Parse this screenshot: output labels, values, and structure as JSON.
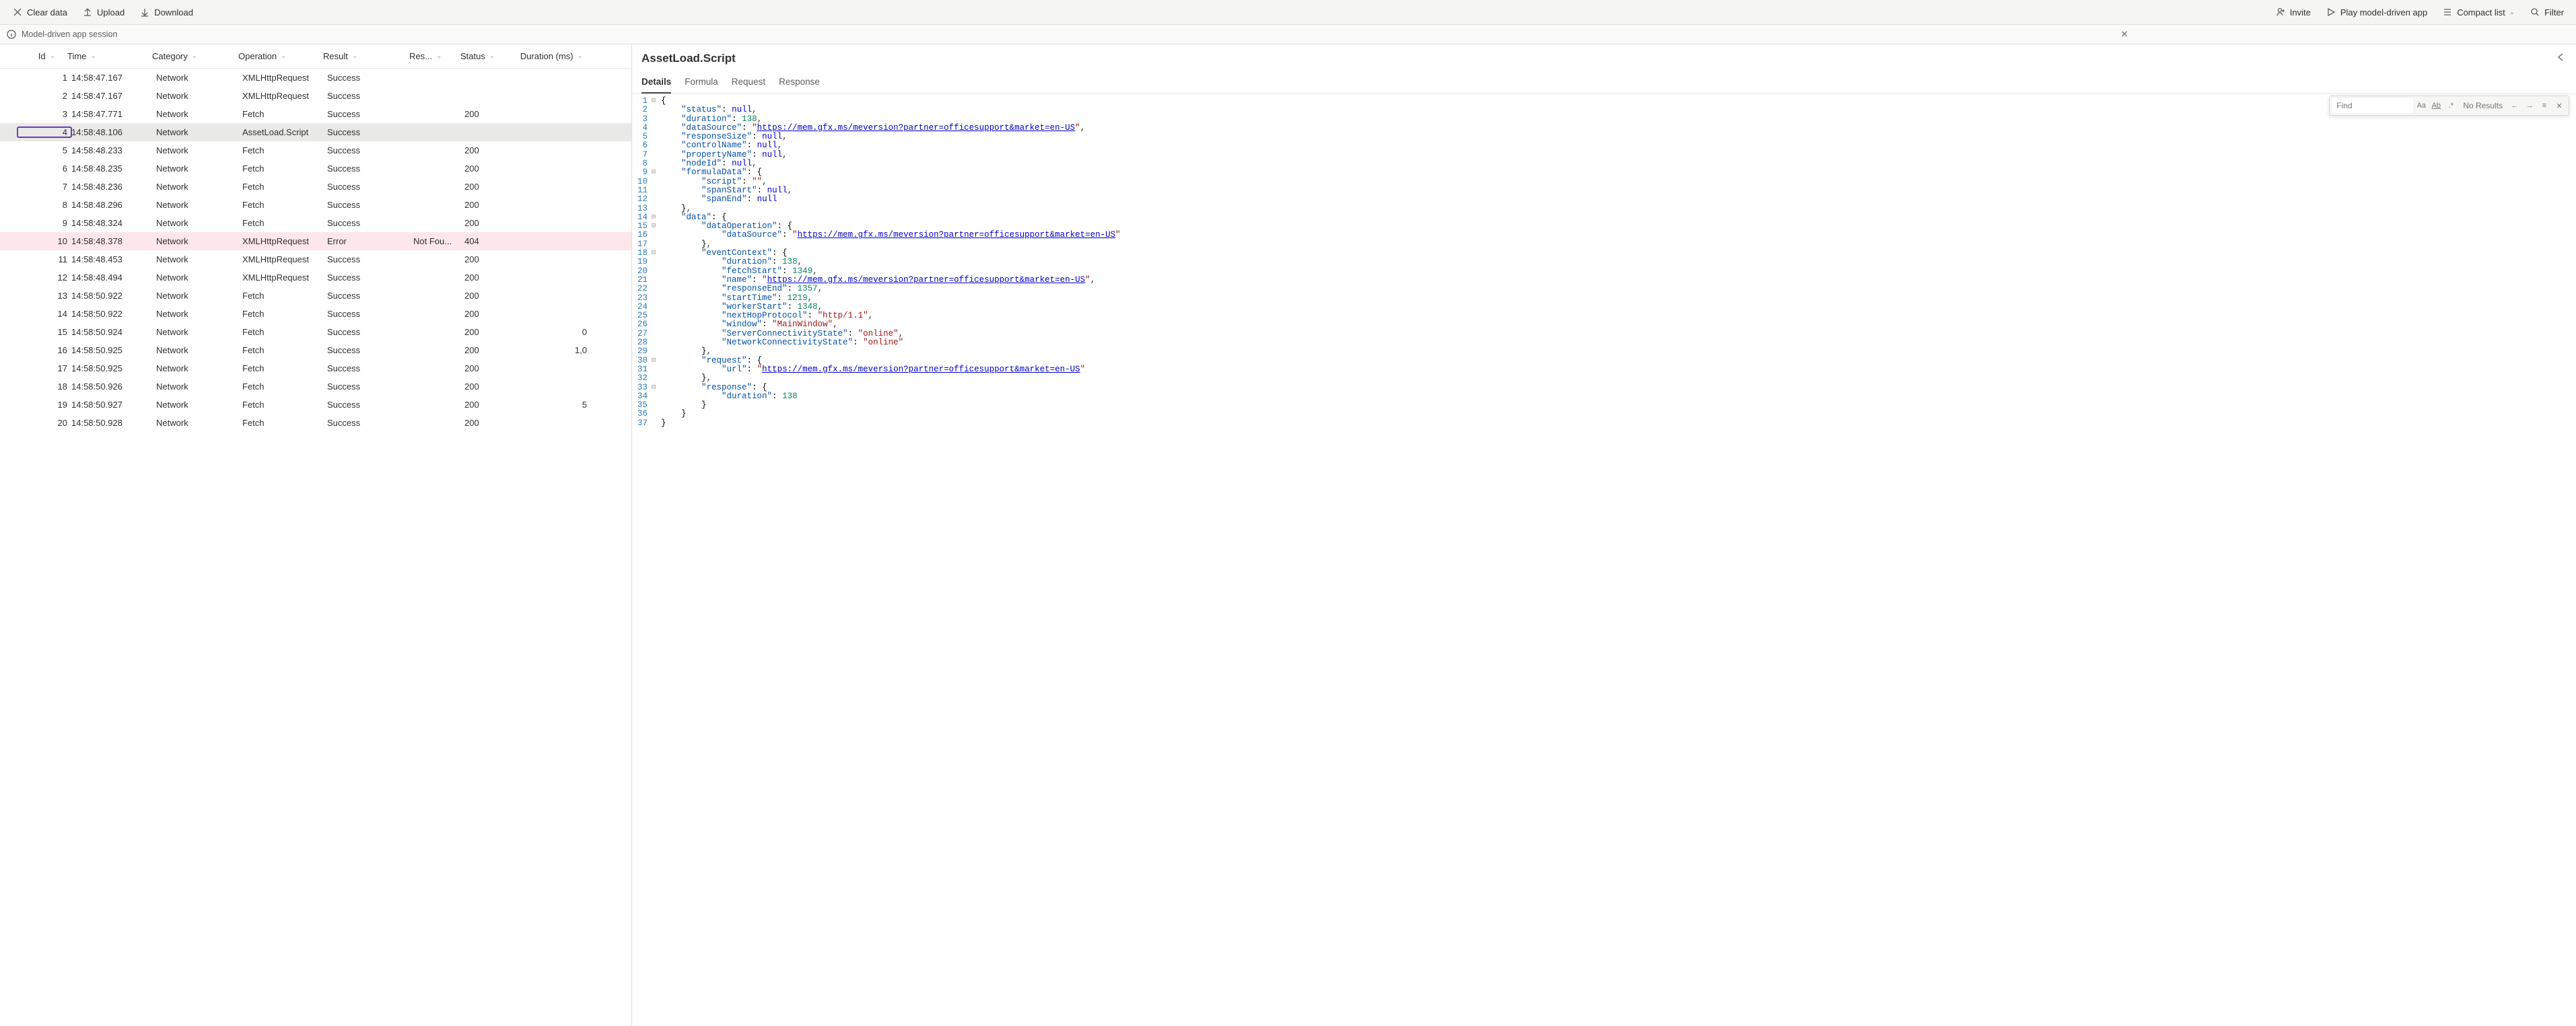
{
  "toolbar": {
    "clear": "Clear data",
    "upload": "Upload",
    "download": "Download",
    "invite": "Invite",
    "play": "Play model-driven app",
    "compact": "Compact list",
    "filter": "Filter"
  },
  "session": {
    "title": "Model-driven app session"
  },
  "table": {
    "headers": {
      "id": "Id",
      "time": "Time",
      "category": "Category",
      "operation": "Operation",
      "result": "Result",
      "res2": "Res...",
      "status": "Status",
      "duration": "Duration (ms)"
    },
    "rows": [
      {
        "id": "1",
        "time": "14:58:47.167",
        "category": "Network",
        "operation": "XMLHttpRequest",
        "result": "Success",
        "res2": "",
        "status": "",
        "dur": "",
        "error": false,
        "selected": false
      },
      {
        "id": "2",
        "time": "14:58:47.167",
        "category": "Network",
        "operation": "XMLHttpRequest",
        "result": "Success",
        "res2": "",
        "status": "",
        "dur": "",
        "error": false,
        "selected": false
      },
      {
        "id": "3",
        "time": "14:58:47.771",
        "category": "Network",
        "operation": "Fetch",
        "result": "Success",
        "res2": "",
        "status": "200",
        "dur": "",
        "error": false,
        "selected": false
      },
      {
        "id": "4",
        "time": "14:58:48.106",
        "category": "Network",
        "operation": "AssetLoad.Script",
        "result": "Success",
        "res2": "",
        "status": "",
        "dur": "",
        "error": false,
        "selected": true
      },
      {
        "id": "5",
        "time": "14:58:48.233",
        "category": "Network",
        "operation": "Fetch",
        "result": "Success",
        "res2": "",
        "status": "200",
        "dur": "",
        "error": false,
        "selected": false
      },
      {
        "id": "6",
        "time": "14:58:48.235",
        "category": "Network",
        "operation": "Fetch",
        "result": "Success",
        "res2": "",
        "status": "200",
        "dur": "",
        "error": false,
        "selected": false
      },
      {
        "id": "7",
        "time": "14:58:48.236",
        "category": "Network",
        "operation": "Fetch",
        "result": "Success",
        "res2": "",
        "status": "200",
        "dur": "",
        "error": false,
        "selected": false
      },
      {
        "id": "8",
        "time": "14:58:48.296",
        "category": "Network",
        "operation": "Fetch",
        "result": "Success",
        "res2": "",
        "status": "200",
        "dur": "",
        "error": false,
        "selected": false
      },
      {
        "id": "9",
        "time": "14:58:48.324",
        "category": "Network",
        "operation": "Fetch",
        "result": "Success",
        "res2": "",
        "status": "200",
        "dur": "",
        "error": false,
        "selected": false
      },
      {
        "id": "10",
        "time": "14:58:48.378",
        "category": "Network",
        "operation": "XMLHttpRequest",
        "result": "Error",
        "res2": "Not Fou...",
        "status": "404",
        "dur": "",
        "error": true,
        "selected": false
      },
      {
        "id": "11",
        "time": "14:58:48.453",
        "category": "Network",
        "operation": "XMLHttpRequest",
        "result": "Success",
        "res2": "",
        "status": "200",
        "dur": "",
        "error": false,
        "selected": false
      },
      {
        "id": "12",
        "time": "14:58:48.494",
        "category": "Network",
        "operation": "XMLHttpRequest",
        "result": "Success",
        "res2": "",
        "status": "200",
        "dur": "",
        "error": false,
        "selected": false
      },
      {
        "id": "13",
        "time": "14:58:50.922",
        "category": "Network",
        "operation": "Fetch",
        "result": "Success",
        "res2": "",
        "status": "200",
        "dur": "",
        "error": false,
        "selected": false
      },
      {
        "id": "14",
        "time": "14:58:50.922",
        "category": "Network",
        "operation": "Fetch",
        "result": "Success",
        "res2": "",
        "status": "200",
        "dur": "",
        "error": false,
        "selected": false
      },
      {
        "id": "15",
        "time": "14:58:50.924",
        "category": "Network",
        "operation": "Fetch",
        "result": "Success",
        "res2": "",
        "status": "200",
        "dur": "0",
        "error": false,
        "selected": false
      },
      {
        "id": "16",
        "time": "14:58:50.925",
        "category": "Network",
        "operation": "Fetch",
        "result": "Success",
        "res2": "",
        "status": "200",
        "dur": "1,0",
        "error": false,
        "selected": false
      },
      {
        "id": "17",
        "time": "14:58:50.925",
        "category": "Network",
        "operation": "Fetch",
        "result": "Success",
        "res2": "",
        "status": "200",
        "dur": "",
        "error": false,
        "selected": false
      },
      {
        "id": "18",
        "time": "14:58:50.926",
        "category": "Network",
        "operation": "Fetch",
        "result": "Success",
        "res2": "",
        "status": "200",
        "dur": "",
        "error": false,
        "selected": false
      },
      {
        "id": "19",
        "time": "14:58:50.927",
        "category": "Network",
        "operation": "Fetch",
        "result": "Success",
        "res2": "",
        "status": "200",
        "dur": "5",
        "error": false,
        "selected": false
      },
      {
        "id": "20",
        "time": "14:58:50.928",
        "category": "Network",
        "operation": "Fetch",
        "result": "Success",
        "res2": "",
        "status": "200",
        "dur": "",
        "error": false,
        "selected": false
      }
    ]
  },
  "details": {
    "title": "AssetLoad.Script",
    "tabs": [
      "Details",
      "Formula",
      "Request",
      "Response"
    ],
    "active_tab": 0,
    "find_placeholder": "Find",
    "find_results": "No Results",
    "payload": {
      "status": null,
      "duration": 138,
      "dataSource": "https://mem.gfx.ms/meversion?partner=officesupport&market=en-US",
      "responseSize": null,
      "controlName": null,
      "propertyName": null,
      "nodeId": null,
      "formulaData": {
        "script": "",
        "spanStart": null,
        "spanEnd": null
      },
      "data": {
        "dataOperation": {
          "dataSource": "https://mem.gfx.ms/meversion?partner=officesupport&market=en-US"
        },
        "eventContext": {
          "duration": 138,
          "fetchStart": 1349,
          "name": "https://mem.gfx.ms/meversion?partner=officesupport&market=en-US",
          "responseEnd": 1357,
          "startTime": 1219,
          "workerStart": 1348,
          "nextHopProtocol": "http/1.1",
          "window": "MainWindow",
          "ServerConnectivityState": "online",
          "NetworkConnectivityState": "online"
        },
        "request": {
          "url": "https://mem.gfx.ms/meversion?partner=officesupport&market=en-US"
        },
        "response": {
          "duration": 138
        }
      }
    }
  }
}
